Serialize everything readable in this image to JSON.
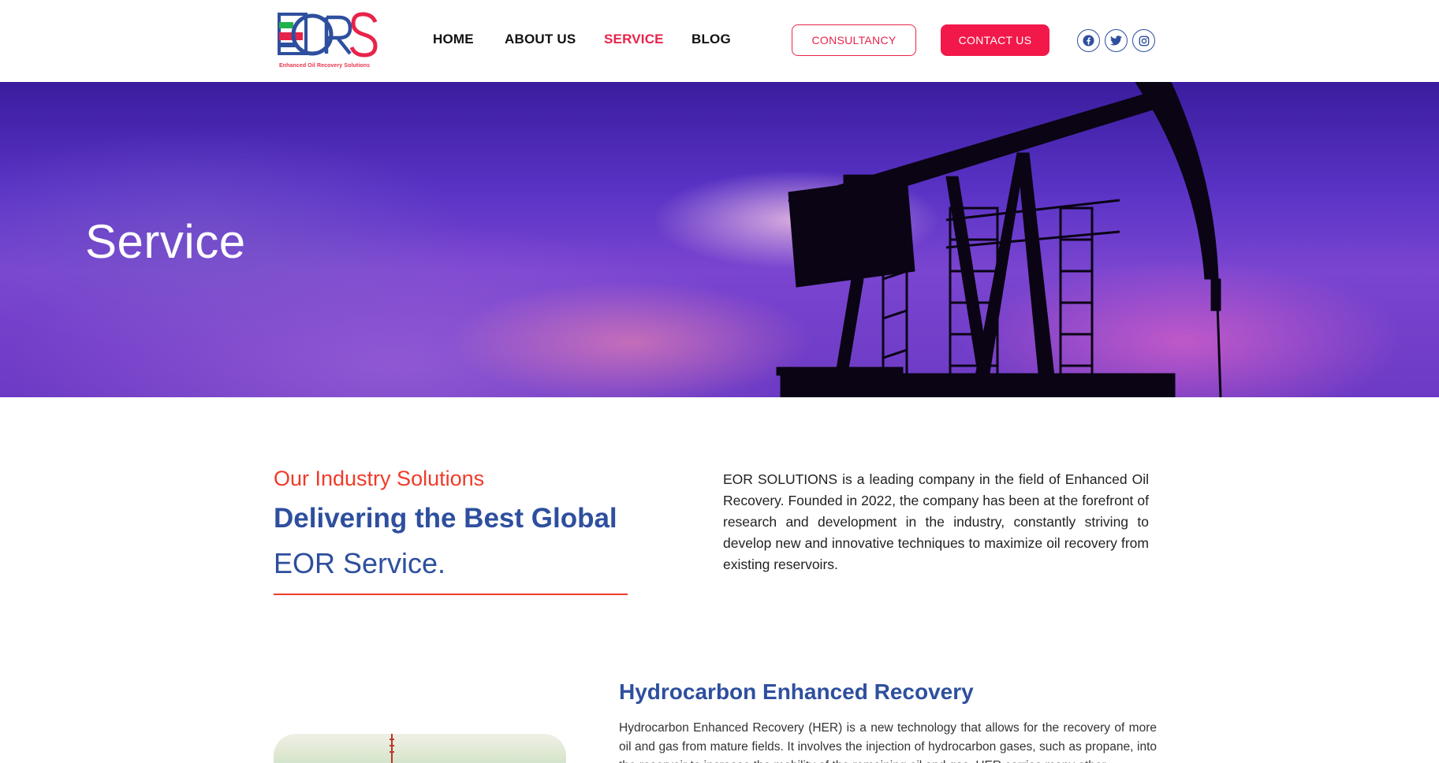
{
  "header": {
    "logo_text": "EORS",
    "logo_tagline": "Enhanced Oil Recovery Solutions",
    "nav": [
      {
        "label": "HOME",
        "active": false
      },
      {
        "label": "ABOUT US",
        "active": false
      },
      {
        "label": "SERVICE",
        "active": true
      },
      {
        "label": "BLOG",
        "active": false
      }
    ],
    "consultancy_label": "CONSULTANCY",
    "contact_label": "CONTACT US",
    "social": [
      "facebook-icon",
      "twitter-icon",
      "instagram-icon"
    ]
  },
  "hero": {
    "title": "Service"
  },
  "intro": {
    "kicker": "Our Industry Solutions",
    "heading_bold": "Delivering the Best Global",
    "heading_light": "EOR Service.",
    "paragraph": "EOR SOLUTIONS is a leading company in the field of Enhanced Oil Recovery. Founded in 2022, the company has been at the forefront of research and development in the industry, constantly striving to develop new and innovative techniques to maximize oil recovery from existing reservoirs."
  },
  "service": {
    "title_bold": "Hydrocarbon Enhanced",
    "title_light": "Recovery",
    "paragraph": "Hydrocarbon Enhanced Recovery (HER) is a new technology that allows for the recovery of more oil and gas from mature fields. It involves the injection of hydrocarbon gases, such as propane, into the reservoir to increase the mobility of the remaining oil and gas. HER carries many other"
  },
  "colors": {
    "brand_blue": "#2e4f9e",
    "brand_red": "#e8234a",
    "accent_orange": "#ef3b2a"
  }
}
